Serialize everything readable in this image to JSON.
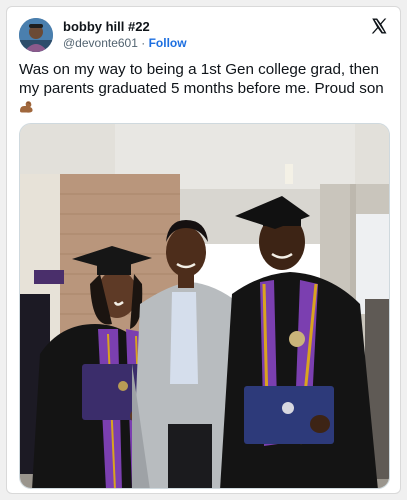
{
  "tweet": {
    "author": {
      "display_name": "bobby hill #22",
      "handle": "@devonte601",
      "separator": "·",
      "follow_label": "Follow",
      "avatar_icon": "profile-avatar"
    },
    "platform_icon": "x-logo-icon",
    "text": "Was on my way to being a 1st Gen college grad, then my parents graduated 5 months before me. Proud son",
    "emoji_icon": "flexed-biceps-emoji",
    "media": {
      "icon": "graduation-photo",
      "gown_color": "#141414",
      "stole_color": "#7b3fb0",
      "cord_color": "#d9a41f"
    }
  }
}
